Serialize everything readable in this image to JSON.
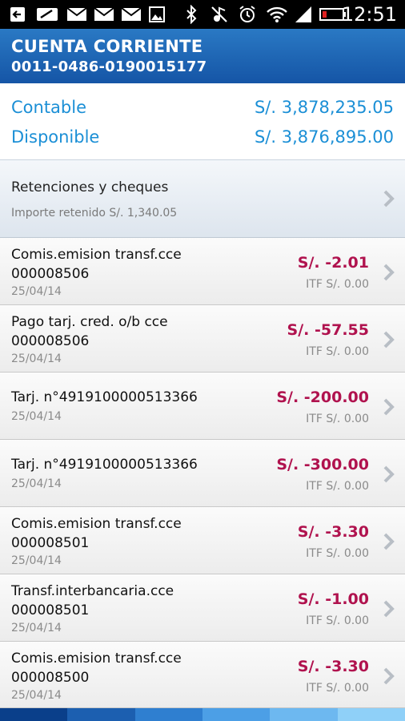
{
  "status_bar": {
    "time": "12:51",
    "icons": [
      "back-arrow-icon",
      "image-icon",
      "mail-icon",
      "mail-icon",
      "mail-icon",
      "gallery-icon",
      "bluetooth-icon",
      "mute-icon",
      "alarm-icon",
      "wifi-icon",
      "signal-icon",
      "battery-icon"
    ]
  },
  "header": {
    "title": "CUENTA CORRIENTE",
    "account": "0011-0486-0190015177"
  },
  "balances": {
    "contable_label": "Contable",
    "contable_value": "S/. 3,878,235.05",
    "disponible_label": "Disponible",
    "disponible_value": "S/. 3,876,895.00"
  },
  "retenciones": {
    "title": "Retenciones y cheques",
    "subtitle": "Importe retenido S/. 1,340.05"
  },
  "transactions": [
    {
      "desc1": "Comis.emision transf.cce",
      "desc2": "000008506",
      "date": "25/04/14",
      "amount": "S/. -2.01",
      "itf": "ITF  S/. 0.00"
    },
    {
      "desc1": "Pago tarj. cred. o/b cce",
      "desc2": "000008506",
      "date": "25/04/14",
      "amount": "S/. -57.55",
      "itf": "ITF  S/. 0.00"
    },
    {
      "desc1": "Tarj. n°4919100000513366",
      "desc2": "",
      "date": "25/04/14",
      "amount": "S/. -200.00",
      "itf": "ITF  S/. 0.00"
    },
    {
      "desc1": "Tarj. n°4919100000513366",
      "desc2": "",
      "date": "25/04/14",
      "amount": "S/. -300.00",
      "itf": "ITF  S/. 0.00"
    },
    {
      "desc1": "Comis.emision transf.cce",
      "desc2": "000008501",
      "date": "25/04/14",
      "amount": "S/. -3.30",
      "itf": "ITF  S/. 0.00"
    },
    {
      "desc1": "Transf.interbancaria.cce",
      "desc2": "000008501",
      "date": "25/04/14",
      "amount": "S/. -1.00",
      "itf": "ITF  S/. 0.00"
    },
    {
      "desc1": "Comis.emision transf.cce",
      "desc2": "000008500",
      "date": "25/04/14",
      "amount": "S/. -3.30",
      "itf": "ITF  S/. 0.00"
    }
  ],
  "colors": {
    "header_blue": "#1a5eaa",
    "balance_blue": "#1b8fd6",
    "amount_red": "#b0124e",
    "bottom_bar": [
      "#0a3f8a",
      "#1c5fb0",
      "#2f7fd0",
      "#4c9fe6",
      "#6db8f0",
      "#8fd0f8"
    ]
  }
}
